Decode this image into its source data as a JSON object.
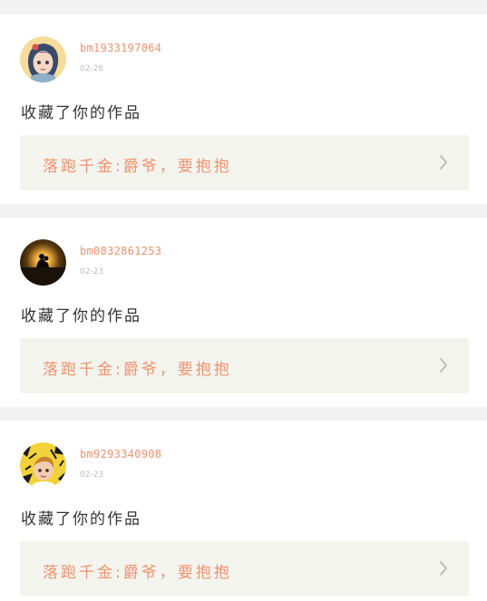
{
  "notifications": [
    {
      "username": "bm1933197064",
      "date": "02-26",
      "message": "收藏了你的作品",
      "work_title": "落跑千金:爵爷，要抱抱",
      "avatar_icon": "girl-cartoon-avatar-icon"
    },
    {
      "username": "bm0832861253",
      "date": "02-23",
      "message": "收藏了你的作品",
      "work_title": "落跑千金:爵爷，要抱抱",
      "avatar_icon": "sunset-silhouette-avatar-icon"
    },
    {
      "username": "bm9293340908",
      "date": "02-23",
      "message": "收藏了你的作品",
      "work_title": "落跑千金:爵爷，要抱抱",
      "avatar_icon": "yellow-cartoon-avatar-icon"
    }
  ],
  "colors": {
    "accent": "#f0926e",
    "text": "#333333",
    "muted": "#bdbdbd",
    "link_bg": "#f4f4ee",
    "page_bg": "#f2f2f2"
  }
}
